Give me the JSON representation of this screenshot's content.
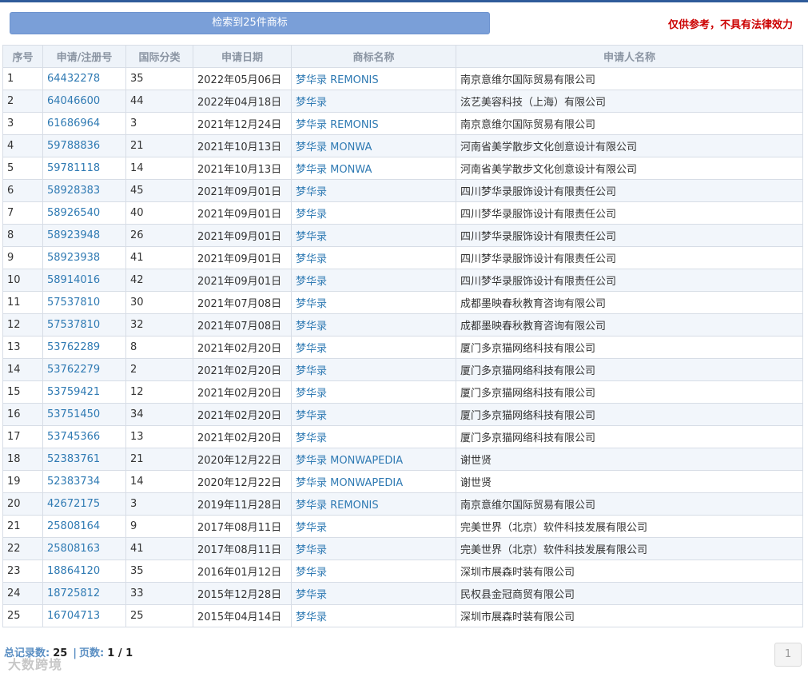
{
  "header": {
    "search_button": "检索到25件商标",
    "disclaimer": "仅供参考，不具有法律效力"
  },
  "table": {
    "columns": [
      "序号",
      "申请/注册号",
      "国际分类",
      "申请日期",
      "商标名称",
      "申请人名称"
    ],
    "rows": [
      [
        "1",
        "64432278",
        "35",
        "2022年05月06日",
        "梦华录 REMONIS",
        "南京意维尔国际贸易有限公司"
      ],
      [
        "2",
        "64046600",
        "44",
        "2022年04月18日",
        "梦华录",
        "泫艺美容科技（上海）有限公司"
      ],
      [
        "3",
        "61686964",
        "3",
        "2021年12月24日",
        "梦华录 REMONIS",
        "南京意维尔国际贸易有限公司"
      ],
      [
        "4",
        "59788836",
        "21",
        "2021年10月13日",
        "梦华录 MONWA",
        "河南省美学散步文化创意设计有限公司"
      ],
      [
        "5",
        "59781118",
        "14",
        "2021年10月13日",
        "梦华录 MONWA",
        "河南省美学散步文化创意设计有限公司"
      ],
      [
        "6",
        "58928383",
        "45",
        "2021年09月01日",
        "梦华录",
        "四川梦华录服饰设计有限责任公司"
      ],
      [
        "7",
        "58926540",
        "40",
        "2021年09月01日",
        "梦华录",
        "四川梦华录服饰设计有限责任公司"
      ],
      [
        "8",
        "58923948",
        "26",
        "2021年09月01日",
        "梦华录",
        "四川梦华录服饰设计有限责任公司"
      ],
      [
        "9",
        "58923938",
        "41",
        "2021年09月01日",
        "梦华录",
        "四川梦华录服饰设计有限责任公司"
      ],
      [
        "10",
        "58914016",
        "42",
        "2021年09月01日",
        "梦华录",
        "四川梦华录服饰设计有限责任公司"
      ],
      [
        "11",
        "57537810",
        "30",
        "2021年07月08日",
        "梦华录",
        "成都墨映春秋教育咨询有限公司"
      ],
      [
        "12",
        "57537810",
        "32",
        "2021年07月08日",
        "梦华录",
        "成都墨映春秋教育咨询有限公司"
      ],
      [
        "13",
        "53762289",
        "8",
        "2021年02月20日",
        "梦华录",
        "厦门多京猫网络科技有限公司"
      ],
      [
        "14",
        "53762279",
        "2",
        "2021年02月20日",
        "梦华录",
        "厦门多京猫网络科技有限公司"
      ],
      [
        "15",
        "53759421",
        "12",
        "2021年02月20日",
        "梦华录",
        "厦门多京猫网络科技有限公司"
      ],
      [
        "16",
        "53751450",
        "34",
        "2021年02月20日",
        "梦华录",
        "厦门多京猫网络科技有限公司"
      ],
      [
        "17",
        "53745366",
        "13",
        "2021年02月20日",
        "梦华录",
        "厦门多京猫网络科技有限公司"
      ],
      [
        "18",
        "52383761",
        "21",
        "2020年12月22日",
        "梦华录 MONWAPEDIA",
        "谢世贤"
      ],
      [
        "19",
        "52383734",
        "14",
        "2020年12月22日",
        "梦华录 MONWAPEDIA",
        "谢世贤"
      ],
      [
        "20",
        "42672175",
        "3",
        "2019年11月28日",
        "梦华录 REMONIS",
        "南京意维尔国际贸易有限公司"
      ],
      [
        "21",
        "25808164",
        "9",
        "2017年08月11日",
        "梦华录",
        "完美世界（北京）软件科技发展有限公司"
      ],
      [
        "22",
        "25808163",
        "41",
        "2017年08月11日",
        "梦华录",
        "完美世界（北京）软件科技发展有限公司"
      ],
      [
        "23",
        "18864120",
        "35",
        "2016年01月12日",
        "梦华录",
        "深圳市展森时装有限公司"
      ],
      [
        "24",
        "18725812",
        "33",
        "2015年12月28日",
        "梦华录",
        "民权县金冠商贸有限公司"
      ],
      [
        "25",
        "16704713",
        "25",
        "2015年04月14日",
        "梦华录",
        "深圳市展森时装有限公司"
      ]
    ]
  },
  "footer": {
    "total_label": "总记录数:",
    "total_value": "25",
    "separator": "|",
    "pages_label": "页数:",
    "pages_value": "1 / 1",
    "pager_current": "1",
    "watermark": "大数跨境"
  },
  "colors": {
    "accent": "#7a9fd8",
    "link": "#2f7ab3",
    "warning": "#cc0000"
  }
}
